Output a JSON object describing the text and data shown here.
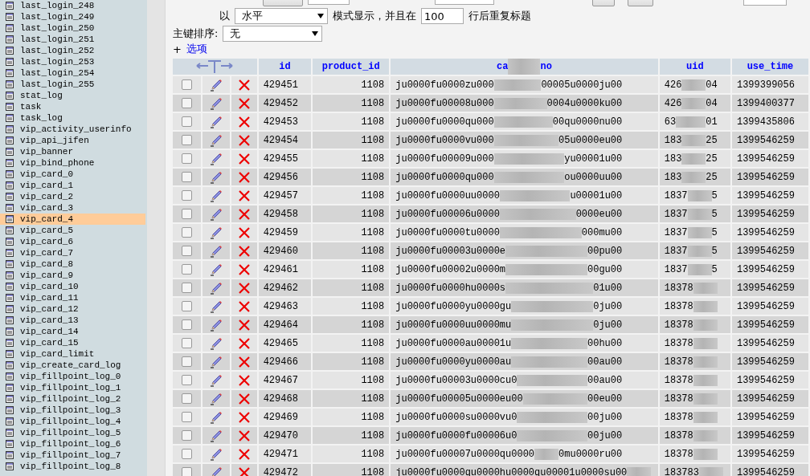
{
  "sidebar": {
    "tables": [
      {
        "name": "last_login_248",
        "selected": false
      },
      {
        "name": "last_login_249",
        "selected": false
      },
      {
        "name": "last_login_250",
        "selected": false
      },
      {
        "name": "last_login_251",
        "selected": false
      },
      {
        "name": "last_login_252",
        "selected": false
      },
      {
        "name": "last_login_253",
        "selected": false
      },
      {
        "name": "last_login_254",
        "selected": false
      },
      {
        "name": "last_login_255",
        "selected": false
      },
      {
        "name": "stat_log",
        "selected": false
      },
      {
        "name": "task",
        "selected": false
      },
      {
        "name": "task_log",
        "selected": false
      },
      {
        "name": "vip_activity_userinfo",
        "selected": false
      },
      {
        "name": "vip_api_jifen",
        "selected": false
      },
      {
        "name": "vip_banner",
        "selected": false
      },
      {
        "name": "vip_bind_phone",
        "selected": false
      },
      {
        "name": "vip_card_0",
        "selected": false
      },
      {
        "name": "vip_card_1",
        "selected": false
      },
      {
        "name": "vip_card_2",
        "selected": false
      },
      {
        "name": "vip_card_3",
        "selected": false
      },
      {
        "name": "vip_card_4",
        "selected": true
      },
      {
        "name": "vip_card_5",
        "selected": false
      },
      {
        "name": "vip_card_6",
        "selected": false
      },
      {
        "name": "vip_card_7",
        "selected": false
      },
      {
        "name": "vip_card_8",
        "selected": false
      },
      {
        "name": "vip_card_9",
        "selected": false
      },
      {
        "name": "vip_card_10",
        "selected": false
      },
      {
        "name": "vip_card_11",
        "selected": false
      },
      {
        "name": "vip_card_12",
        "selected": false
      },
      {
        "name": "vip_card_13",
        "selected": false
      },
      {
        "name": "vip_card_14",
        "selected": false
      },
      {
        "name": "vip_card_15",
        "selected": false
      },
      {
        "name": "vip_card_limit",
        "selected": false
      },
      {
        "name": "vip_create_card_log",
        "selected": false
      },
      {
        "name": "vip_fillpoint_log_0",
        "selected": false
      },
      {
        "name": "vip_fillpoint_log_1",
        "selected": false
      },
      {
        "name": "vip_fillpoint_log_2",
        "selected": false
      },
      {
        "name": "vip_fillpoint_log_3",
        "selected": false
      },
      {
        "name": "vip_fillpoint_log_4",
        "selected": false
      },
      {
        "name": "vip_fillpoint_log_5",
        "selected": false
      },
      {
        "name": "vip_fillpoint_log_6",
        "selected": false
      },
      {
        "name": "vip_fillpoint_log_7",
        "selected": false
      },
      {
        "name": "vip_fillpoint_log_8",
        "selected": false
      }
    ]
  },
  "display": {
    "prefix": "以",
    "mode_select": "水平",
    "mode_label": "模式显示，并且在",
    "repeat_input": "100",
    "repeat_label": "行后重复标题"
  },
  "sort": {
    "label": "主键排序:",
    "select": "无"
  },
  "options": {
    "toggle": "+",
    "link": "选项"
  },
  "table": {
    "columns": [
      {
        "kind": "plain",
        "label": "id"
      },
      {
        "kind": "plain",
        "label": "product_id"
      },
      {
        "kind": "masked",
        "start": "ca",
        "end": "no"
      },
      {
        "kind": "plain",
        "label": "uid"
      },
      {
        "kind": "plain",
        "label": "use_time"
      }
    ],
    "rows": [
      {
        "checked": false,
        "id": "429451",
        "product_id": "1108",
        "card_no": {
          "start": "ju0000fu0000zu000",
          "end": "00005u0000ju00"
        },
        "uid": {
          "start": "426",
          "end": "04"
        },
        "use_time": "1399399056"
      },
      {
        "checked": false,
        "id": "429452",
        "product_id": "1108",
        "card_no": {
          "start": "ju0000fu00008u000",
          "end": "0004u0000ku00"
        },
        "uid": {
          "start": "426",
          "end": "04"
        },
        "use_time": "1399400377"
      },
      {
        "checked": false,
        "id": "429453",
        "product_id": "1108",
        "card_no": {
          "start": "ju0000fu0000qu000",
          "end": "00qu0000nu00"
        },
        "uid": {
          "start": "63",
          "end": "01"
        },
        "use_time": "1399435806"
      },
      {
        "checked": false,
        "id": "429454",
        "product_id": "1108",
        "card_no": {
          "start": "ju0000fu0000vu000",
          "end": "05u0000eu00"
        },
        "uid": {
          "start": "183",
          "end": "25"
        },
        "use_time": "1399546259"
      },
      {
        "checked": false,
        "id": "429455",
        "product_id": "1108",
        "card_no": {
          "start": "ju0000fu00009u000",
          "end": "yu00001u00"
        },
        "uid": {
          "start": "183",
          "end": "25"
        },
        "use_time": "1399546259"
      },
      {
        "checked": false,
        "id": "429456",
        "product_id": "1108",
        "card_no": {
          "start": "ju0000fu0000qu000",
          "end": "ou0000uu00"
        },
        "uid": {
          "start": "183",
          "end": "25"
        },
        "use_time": "1399546259"
      },
      {
        "checked": false,
        "id": "429457",
        "product_id": "1108",
        "card_no": {
          "start": "ju0000fu0000uu0000",
          "end": "u00001u00"
        },
        "uid": {
          "start": "1837",
          "end": "5"
        },
        "use_time": "1399546259"
      },
      {
        "checked": false,
        "id": "429458",
        "product_id": "1108",
        "card_no": {
          "start": "ju0000fu00006u0000",
          "end": "0000eu00"
        },
        "uid": {
          "start": "1837",
          "end": "5"
        },
        "use_time": "1399546259"
      },
      {
        "checked": false,
        "id": "429459",
        "product_id": "1108",
        "card_no": {
          "start": "ju0000fu0000tu0000",
          "end": "000mu00"
        },
        "uid": {
          "start": "1837",
          "end": "5"
        },
        "use_time": "1399546259"
      },
      {
        "checked": false,
        "id": "429460",
        "product_id": "1108",
        "card_no": {
          "start": "ju0000fu00003u0000e",
          "end": "00pu00"
        },
        "uid": {
          "start": "1837",
          "end": "5"
        },
        "use_time": "1399546259"
      },
      {
        "checked": false,
        "id": "429461",
        "product_id": "1108",
        "card_no": {
          "start": "ju0000fu00002u0000m",
          "end": "00gu00"
        },
        "uid": {
          "start": "1837",
          "end": "5"
        },
        "use_time": "1399546259"
      },
      {
        "checked": false,
        "id": "429462",
        "product_id": "1108",
        "card_no": {
          "start": "ju0000fu0000hu0000s",
          "end": "01u00"
        },
        "uid": {
          "start": "18378"
        },
        "use_time": "1399546259"
      },
      {
        "checked": false,
        "id": "429463",
        "product_id": "1108",
        "card_no": {
          "start": "ju0000fu0000yu0000gu",
          "end": "0ju00"
        },
        "uid": {
          "start": "18378"
        },
        "use_time": "1399546259"
      },
      {
        "checked": false,
        "id": "429464",
        "product_id": "1108",
        "card_no": {
          "start": "ju0000fu0000uu0000mu",
          "end": "0ju00"
        },
        "uid": {
          "start": "18378"
        },
        "use_time": "1399546259"
      },
      {
        "checked": false,
        "id": "429465",
        "product_id": "1108",
        "card_no": {
          "start": "ju0000fu0000au00001u",
          "end": "00hu00"
        },
        "uid": {
          "start": "18378"
        },
        "use_time": "1399546259"
      },
      {
        "checked": false,
        "id": "429466",
        "product_id": "1108",
        "card_no": {
          "start": "ju0000fu0000yu0000au",
          "end": "00au00"
        },
        "uid": {
          "start": "18378"
        },
        "use_time": "1399546259"
      },
      {
        "checked": false,
        "id": "429467",
        "product_id": "1108",
        "card_no": {
          "start": "ju0000fu00003u0000cu0",
          "end": "00au00"
        },
        "uid": {
          "start": "18378"
        },
        "use_time": "1399546259"
      },
      {
        "checked": false,
        "id": "429468",
        "product_id": "1108",
        "card_no": {
          "start": "ju0000fu00005u0000eu00",
          "end": "00eu00"
        },
        "uid": {
          "start": "18378"
        },
        "use_time": "1399546259"
      },
      {
        "checked": false,
        "id": "429469",
        "product_id": "1108",
        "card_no": {
          "start": "ju0000fu0000su0000vu0",
          "end": "00ju00"
        },
        "uid": {
          "start": "18378"
        },
        "use_time": "1399546259"
      },
      {
        "checked": false,
        "id": "429470",
        "product_id": "1108",
        "card_no": {
          "start": "ju0000fu0000fu00006u0",
          "end": "00ju00"
        },
        "uid": {
          "start": "18378"
        },
        "use_time": "1399546259"
      },
      {
        "checked": false,
        "id": "429471",
        "product_id": "1108",
        "card_no": {
          "start": "ju0000fu00007u0000qu0000",
          "end": "0mu0000ru00"
        },
        "uid": {
          "start": "18378"
        },
        "use_time": "1399546259"
      },
      {
        "checked": false,
        "id": "429472",
        "product_id": "1108",
        "card_no": {
          "start": "ju0000fu0000qu0000hu0000qu00001u0000su00"
        },
        "uid": {
          "start": "183783"
        },
        "use_time": "1399546259"
      }
    ]
  }
}
